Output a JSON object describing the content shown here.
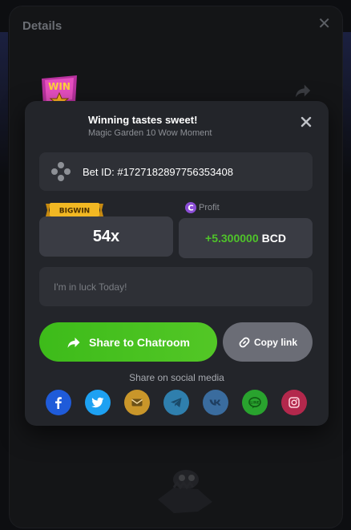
{
  "background": {
    "panel_title": "Details",
    "win_logo_text": "WIN"
  },
  "modal": {
    "title": "Winning tastes sweet!",
    "subtitle": "Magic Garden 10 Wow Moment",
    "bet_id": "Bet ID: #1727182897756353408",
    "badge": "BIGWIN",
    "profit_label": "Profit",
    "multiplier": "54x",
    "profit_value": "+5.300000",
    "profit_currency": "BCD",
    "message_placeholder": "I'm in luck Today!",
    "share_chatroom_label": "Share to Chatroom",
    "copy_link_label": "Copy link",
    "share_social_label": "Share on social media"
  },
  "social": [
    {
      "name": "facebook",
      "icon": "facebook-icon",
      "color": "#1f5bd9"
    },
    {
      "name": "twitter",
      "icon": "twitter-icon",
      "color": "#1da1f2"
    },
    {
      "name": "email",
      "icon": "email-icon",
      "color": "#c9962a"
    },
    {
      "name": "telegram",
      "icon": "telegram-icon",
      "color": "#2f7fad"
    },
    {
      "name": "vk",
      "icon": "vk-icon",
      "color": "#3a6c9e"
    },
    {
      "name": "line",
      "icon": "line-icon",
      "color": "#29a32e"
    },
    {
      "name": "instagram",
      "icon": "instagram-icon",
      "color": "#b3284c"
    }
  ],
  "colors": {
    "accent_green": "#4fc32a",
    "modal_bg": "#23252a",
    "field_bg": "#2e3036",
    "badge_gold": "#f2b823",
    "profit_coin": "#8b4dd6"
  }
}
